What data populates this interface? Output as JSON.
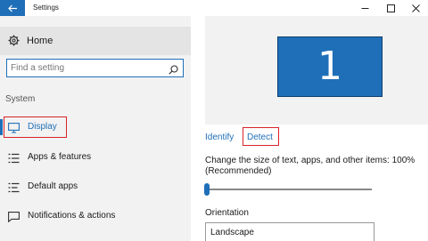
{
  "window": {
    "title": "Settings"
  },
  "sidebar": {
    "home_label": "Home",
    "search": {
      "placeholder": "Find a setting"
    },
    "section_label": "System",
    "items": [
      {
        "label": "Display",
        "icon": "monitor-icon",
        "selected": true
      },
      {
        "label": "Apps & features",
        "icon": "list-icon",
        "selected": false
      },
      {
        "label": "Default apps",
        "icon": "list-check-icon",
        "selected": false
      },
      {
        "label": "Notifications & actions",
        "icon": "notification-icon",
        "selected": false
      }
    ]
  },
  "main": {
    "monitor_number": "1",
    "identify_label": "Identify",
    "detect_label": "Detect",
    "scale_text": "Change the size of text, apps, and other items: 100% (Recommended)",
    "scale_slider_fraction": 0.0,
    "orientation_label": "Orientation",
    "orientation_value": "Landscape"
  },
  "colors": {
    "accent": "#1f6fb8",
    "highlight_box": "#d8232a",
    "sidebar_bg": "#f2f2f2"
  }
}
